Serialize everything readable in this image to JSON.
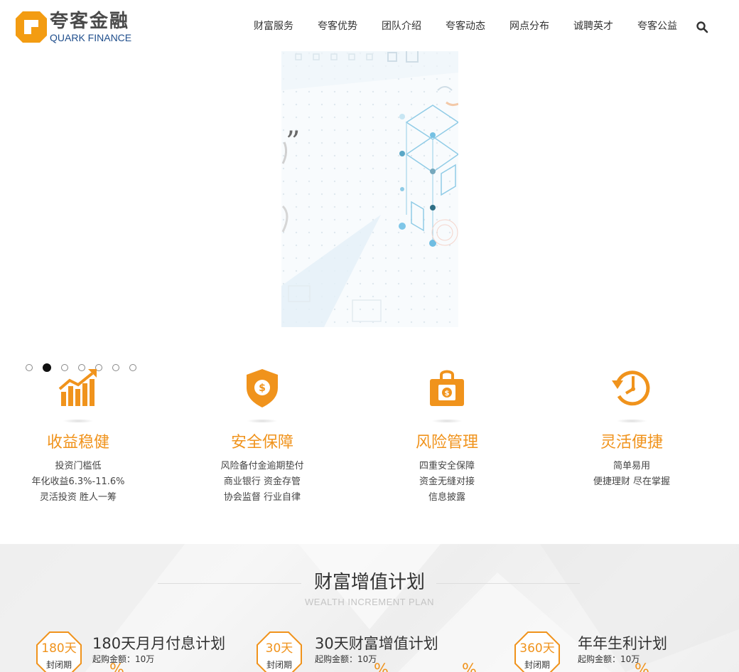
{
  "header": {
    "logo_cn": "夸客金融",
    "logo_en": "QUARK FINANCE",
    "nav": [
      "财富服务",
      "夸客优势",
      "团队介绍",
      "夸客动态",
      "网点分布",
      "诚聘英才",
      "夸客公益"
    ],
    "search_icon": "search-icon"
  },
  "banner": {
    "quote_glyph": "”",
    "slide_count": 7,
    "active_slide": 2
  },
  "features": [
    {
      "icon": "growth-chart-icon",
      "title": "收益稳健",
      "lines": [
        "投资门槛低",
        "年化收益6.3%-11.6%",
        "灵活投资 胜人一筹"
      ]
    },
    {
      "icon": "shield-dollar-icon",
      "title": "安全保障",
      "lines": [
        "风险备付金逾期垫付",
        "商业银行 资金存管",
        "协会监督 行业自律"
      ]
    },
    {
      "icon": "safe-bag-icon",
      "title": "风险管理",
      "lines": [
        "四重安全保障",
        "资金无缝对接",
        "信息披露"
      ]
    },
    {
      "icon": "clock-refresh-icon",
      "title": "灵活便捷",
      "lines": [
        "简单易用",
        "便捷理财 尽在掌握"
      ]
    }
  ],
  "plans_section": {
    "title": "财富增值计划",
    "subtitle": "WEALTH INCREMENT PLAN",
    "plans": [
      {
        "days": "180天",
        "badge_label": "封闭期",
        "name": "180天月月付息计划",
        "min_amount": "起购金额：10万",
        "pct": "%"
      },
      {
        "days": "30天",
        "badge_label": "封闭期",
        "name": "30天财富增值计划",
        "min_amount": "起购金额：10万",
        "pct": "%",
        "pct2": "%"
      },
      {
        "days": "360天",
        "badge_label": "封闭期",
        "name": "年年生利计划",
        "min_amount": "起购金额：10万",
        "pct": "%"
      }
    ]
  },
  "colors": {
    "accent": "#f0931c",
    "logo_orange": "#f39c12",
    "logo_blue": "#1f4e8c"
  }
}
